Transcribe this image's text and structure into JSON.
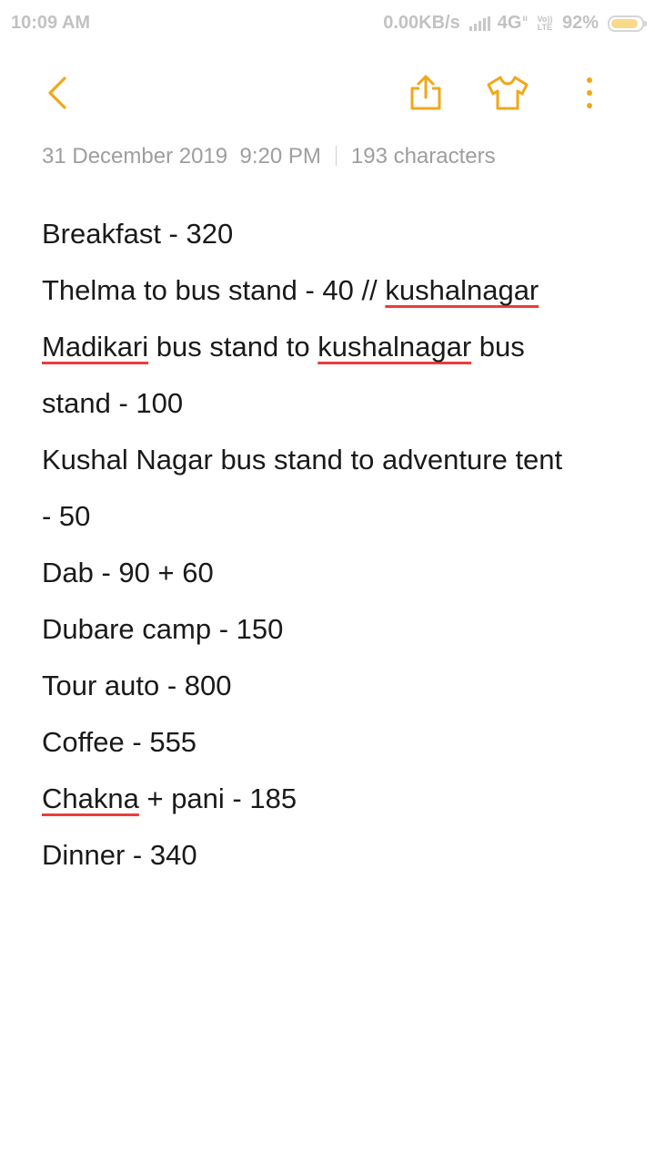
{
  "status_bar": {
    "time": "10:09 AM",
    "net_speed": "0.00KB/s",
    "network": "4G",
    "volte_top": "Vo))",
    "volte_bottom": "LTE",
    "battery": "92%",
    "battery_level": 0.92
  },
  "toolbar": {
    "back_icon": "chevron-left-icon",
    "share_icon": "share-icon",
    "theme_icon": "tshirt-icon",
    "more_icon": "more-vertical-icon",
    "accent_color": "#f0a818"
  },
  "meta": {
    "date": "31 December 2019",
    "time": "9:20 PM",
    "char_count": "193 characters"
  },
  "note": {
    "l1": "Breakfast - 320",
    "l2a": "Thelma to bus stand - 40 // ",
    "l2b": "kushalnagar",
    "l3a": "Madikari",
    "l3b": " bus stand to ",
    "l3c": "kushalnagar",
    "l3d": " bus",
    "l4": "stand - 100",
    "l5": "Kushal Nagar bus stand to adventure tent",
    "l6": "- 50",
    "l7": "Dab - 90 + 60",
    "l8": "Dubare camp - 150",
    "l9": "Tour auto - 800",
    "l10": "Coffee - 555",
    "l11a": "Chakna",
    "l11b": " + pani - 185",
    "l12": "Dinner - 340"
  }
}
